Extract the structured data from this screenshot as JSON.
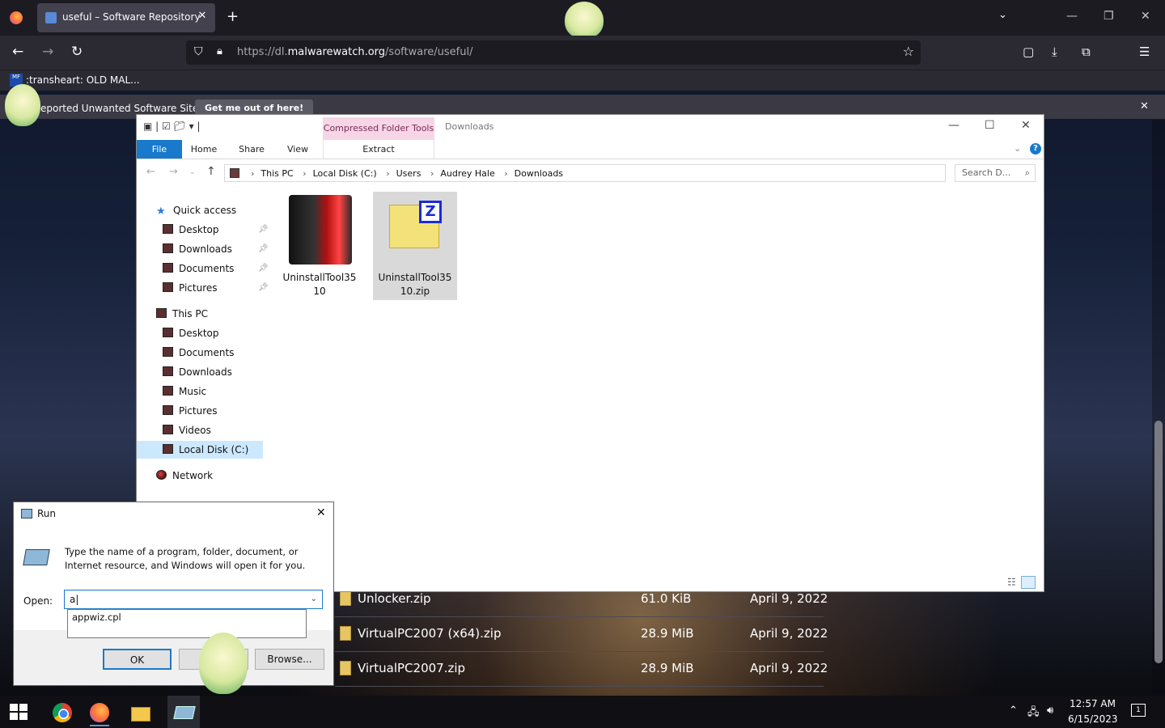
{
  "browser": {
    "tab_title": "useful – Software Repository",
    "tab_close": "✕",
    "new_tab": "+",
    "url_prefix": "https://dl.",
    "url_domain": "malwarewatch.org",
    "url_path": "/software/useful/",
    "bookmark_icon_text": "MF",
    "bookmark_label": ":transheart: OLD MAL...",
    "warning_text": "eported Unwanted Software Site!",
    "warning_button": "Get me out of here!"
  },
  "page_files": [
    {
      "name": "Unlocker.zip",
      "size": "61.0 KiB",
      "date": "April 9, 2022"
    },
    {
      "name": "VirtualPC2007 (x64).zip",
      "size": "28.9 MiB",
      "date": "April 9, 2022"
    },
    {
      "name": "VirtualPC2007.zip",
      "size": "28.9 MiB",
      "date": "April 9, 2022"
    }
  ],
  "explorer": {
    "context_tab": "Compressed Folder Tools",
    "window_title": "Downloads",
    "ribbon_tabs": {
      "file": "File",
      "home": "Home",
      "share": "Share",
      "view": "View",
      "extract": "Extract"
    },
    "breadcrumbs": [
      "This PC",
      "Local Disk (C:)",
      "Users",
      "Audrey Hale",
      "Downloads"
    ],
    "search_placeholder": "Search D...",
    "nav": {
      "quick_access": "Quick access",
      "qa_items": [
        "Desktop",
        "Downloads",
        "Documents",
        "Pictures"
      ],
      "this_pc": "This PC",
      "pc_items": [
        "Desktop",
        "Documents",
        "Downloads",
        "Music",
        "Pictures",
        "Videos",
        "Local Disk (C:)"
      ],
      "network": "Network"
    },
    "files": [
      {
        "line1": "UninstallTool35",
        "line2": "10"
      },
      {
        "line1": "UninstallTool35",
        "line2": "10.zip"
      }
    ],
    "zip_badge": "Z"
  },
  "run_dialog": {
    "title": "Run",
    "description": "Type the name of a program, folder, document, or Internet resource, and Windows will open it for you.",
    "open_label": "Open:",
    "input_value": "a",
    "suggestion": "appwiz.cpl",
    "ok_label": "OK",
    "cancel_label": "",
    "browse_label": "Browse..."
  },
  "taskbar": {
    "time": "12:57 AM",
    "date": "6/15/2023",
    "notification_count": "1"
  },
  "colors": {
    "accent": "#1979ca",
    "browser_dark": "#1c1b22",
    "context_tab": "#f6d6e6"
  }
}
